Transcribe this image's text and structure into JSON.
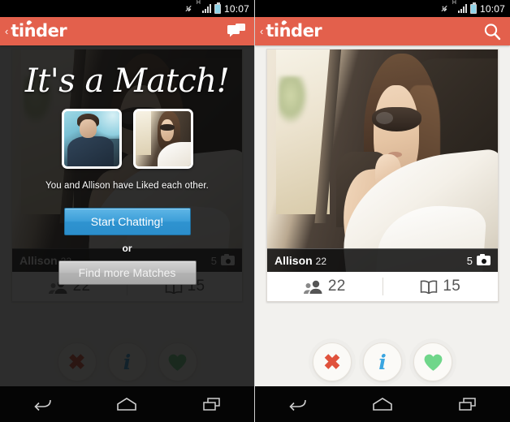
{
  "status_bar": {
    "time": "10:07",
    "icons": [
      "vibrate-icon",
      "signal-h-icon",
      "battery-icon"
    ],
    "network_label": "H"
  },
  "app": {
    "brand": "tinder",
    "back_chevron": "‹",
    "accent_color": "#e3604c"
  },
  "left_screen": {
    "app_bar": {
      "icon": "chat-bubble-icon"
    },
    "match_overlay": {
      "title": "It's a Match!",
      "thumbs": [
        {
          "alt": "your-profile-photo"
        },
        {
          "alt": "match-profile-photo"
        }
      ],
      "liked_text": "You and Allison have Liked each other.",
      "primary_button": "Start Chatting!",
      "divider_text": "or",
      "secondary_button": "Find more Matches"
    },
    "card_behind": {
      "name": "Allison",
      "age": "22",
      "photo_count": "5",
      "stats": [
        {
          "icon": "friends-icon",
          "value": "22"
        },
        {
          "icon": "interests-book-icon",
          "value": "15"
        }
      ]
    },
    "actions": [
      {
        "icon": "nope-x-icon",
        "glyph": "✖"
      },
      {
        "icon": "info-i-icon",
        "glyph": "i"
      },
      {
        "icon": "like-heart-icon",
        "glyph": "heart"
      }
    ]
  },
  "right_screen": {
    "app_bar": {
      "icon": "search-icon"
    },
    "card": {
      "name": "Allison",
      "age": "22",
      "photo_count": "5",
      "stats": [
        {
          "icon": "friends-icon",
          "value": "22"
        },
        {
          "icon": "interests-book-icon",
          "value": "15"
        }
      ]
    },
    "actions": [
      {
        "icon": "nope-x-icon",
        "glyph": "✖"
      },
      {
        "icon": "info-i-icon",
        "glyph": "i"
      },
      {
        "icon": "like-heart-icon",
        "glyph": "heart"
      }
    ]
  },
  "nav_bar": {
    "buttons": [
      "back-icon",
      "home-icon",
      "recents-icon"
    ]
  },
  "colors": {
    "accent_orange": "#e3604c",
    "chat_blue": "#3d9fd9",
    "nope_red": "#e0523c",
    "info_blue": "#3aa5e0",
    "like_green": "#6fd68a",
    "page_bg": "#f2f1ee"
  }
}
